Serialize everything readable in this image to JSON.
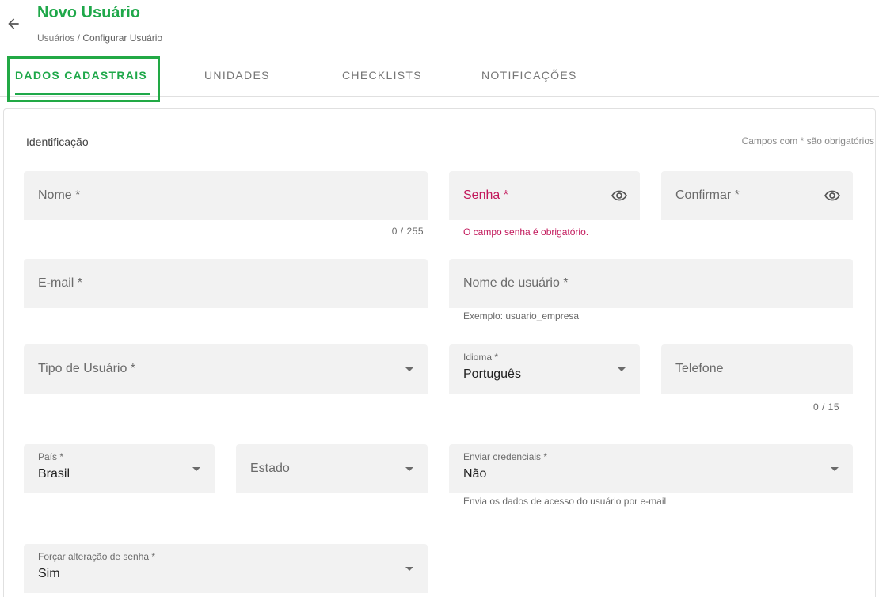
{
  "header": {
    "title": "Novo Usuário",
    "breadcrumb_parent": "Usuários /",
    "breadcrumb_current": "Configurar Usuário"
  },
  "tabs": [
    {
      "label": "DADOS CADASTRAIS",
      "active": true
    },
    {
      "label": "UNIDADES",
      "active": false
    },
    {
      "label": "CHECKLISTS",
      "active": false
    },
    {
      "label": "NOTIFICAÇÕES",
      "active": false
    }
  ],
  "form": {
    "section_title": "Identificação",
    "required_note": "Campos com * são obrigatórios",
    "nome": {
      "label": "Nome *",
      "counter": "0 / 255"
    },
    "senha": {
      "label": "Senha *",
      "error": "O campo senha é obrigatório."
    },
    "confirmar": {
      "label": "Confirmar *"
    },
    "email": {
      "label": "E-mail *"
    },
    "nome_usuario": {
      "label": "Nome de usuário *",
      "hint": "Exemplo: usuario_empresa"
    },
    "tipo_usuario": {
      "label": "Tipo de Usuário *"
    },
    "idioma": {
      "label": "Idioma *",
      "value": "Português"
    },
    "telefone": {
      "label": "Telefone",
      "counter": "0 / 15"
    },
    "pais": {
      "label": "País *",
      "value": "Brasil"
    },
    "estado": {
      "label": "Estado"
    },
    "enviar_credenciais": {
      "label": "Enviar credenciais *",
      "value": "Não",
      "hint": "Envia os dados de acesso do usuário por e-mail"
    },
    "forcar_senha": {
      "label": "Forçar alteração de senha *",
      "value": "Sim"
    }
  },
  "colors": {
    "accent": "#1fa84a",
    "error": "#c2185b",
    "field_bg": "#f2f2f2",
    "highlight_box": "#22a945"
  },
  "icons": {
    "back": "arrow-left-icon",
    "password_visibility": "eye-icon",
    "dropdown": "caret-down-icon"
  }
}
